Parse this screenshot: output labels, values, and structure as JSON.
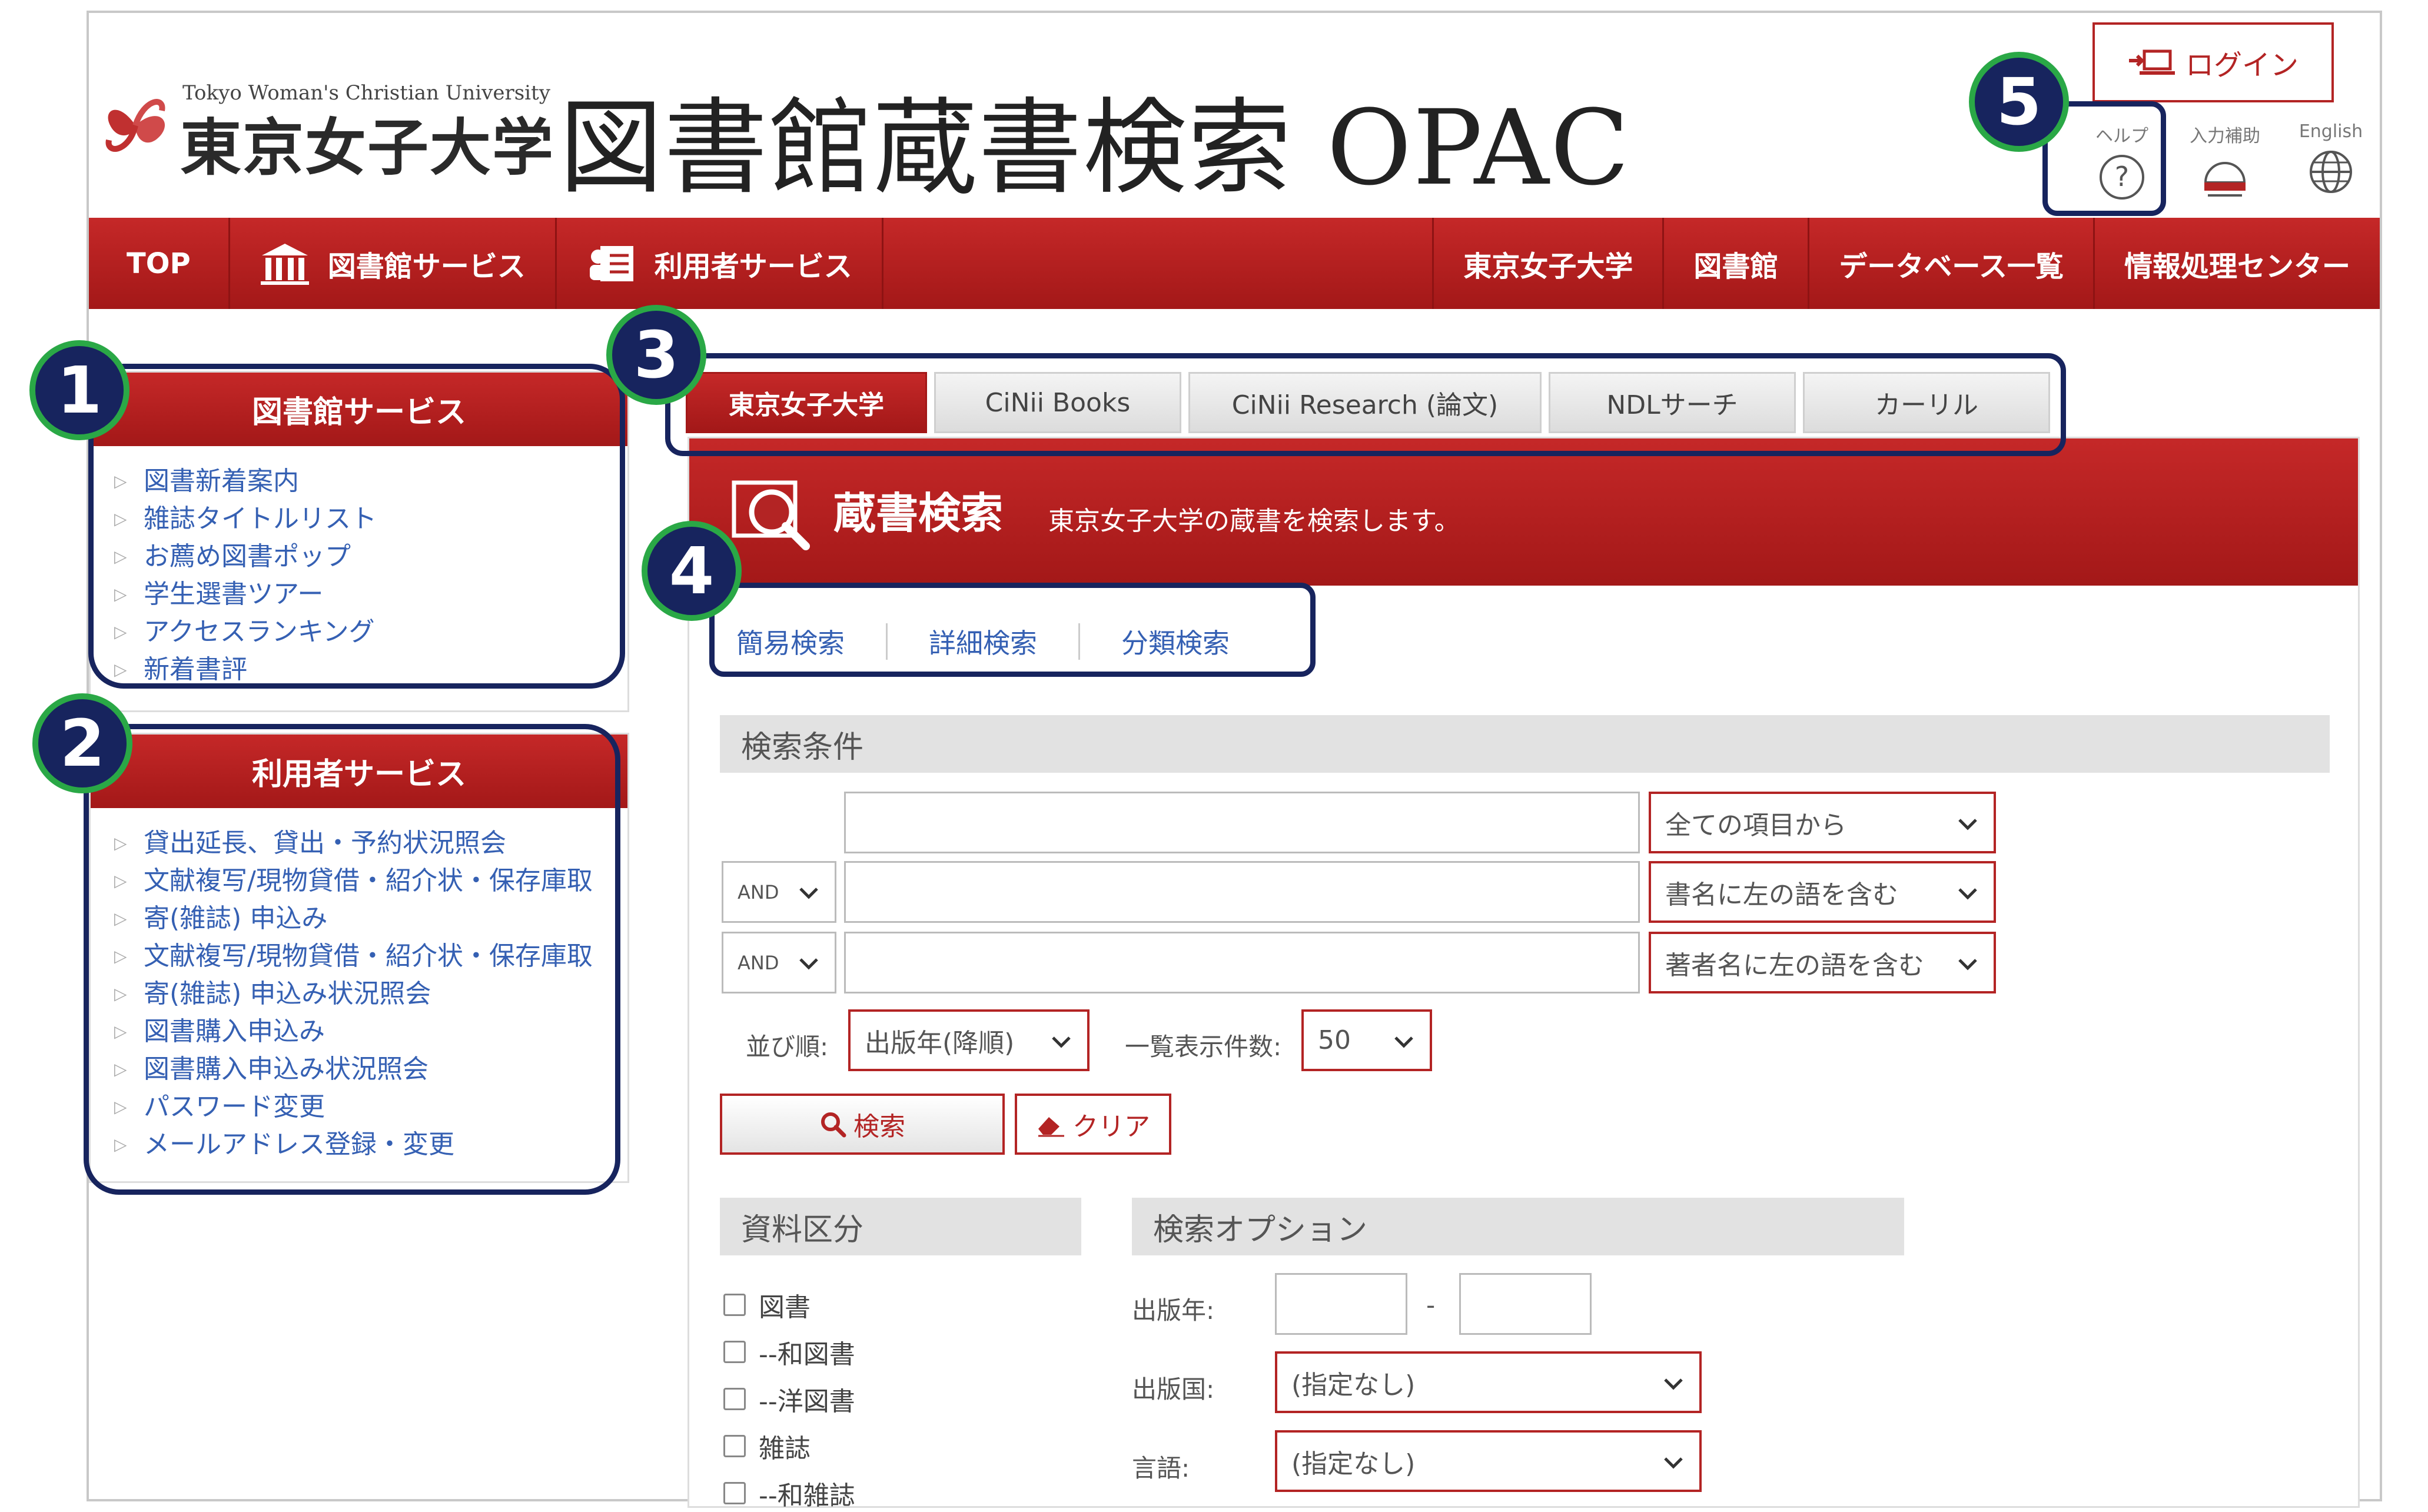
{
  "header": {
    "logo_en": "Tokyo Woman's Christian University",
    "logo_jp": "東京女子大学",
    "page_title": "図書館蔵書検索 OPAC",
    "login_label": "ログイン",
    "help_label": "ヘルプ",
    "input_assist_label": "入力補助",
    "english_label": "English"
  },
  "nav": {
    "top": "TOP",
    "library_services": "図書館サービス",
    "user_services": "利用者サービス",
    "univ": "東京女子大学",
    "library": "図書館",
    "database_list": "データベース一覧",
    "it_center": "情報処理センター"
  },
  "sidebar_library": {
    "title": "図書館サービス",
    "items": [
      "図書新着案内",
      "雑誌タイトルリスト",
      "お薦め図書ポップ",
      "学生選書ツアー",
      "アクセスランキング",
      "新着書評"
    ]
  },
  "sidebar_user": {
    "title": "利用者サービス",
    "items": [
      "貸出延長、貸出・予約状況照会",
      "文献複写/現物貸借・紹介状・保存庫取",
      "寄(雑誌) 申込み",
      "文献複写/現物貸借・紹介状・保存庫取",
      "寄(雑誌) 申込み状況照会",
      "図書購入申込み",
      "図書購入申込み状況照会",
      "パスワード変更",
      "メールアドレス登録・変更"
    ]
  },
  "tabs": [
    "東京女子大学",
    "CiNii Books",
    "CiNii Research (論文)",
    "NDLサーチ",
    "カーリル"
  ],
  "panel": {
    "title": "蔵書検索",
    "description": "東京女子大学の蔵書を検索します。",
    "subtabs": [
      "簡易検索",
      "詳細検索",
      "分類検索"
    ],
    "conditions_title": "検索条件",
    "field1_select": "全ての項目から",
    "field2_select": "書名に左の語を含む",
    "field3_select": "著者名に左の語を含む",
    "op2": "AND",
    "op3": "AND",
    "sort_label": "並び順:",
    "sort_value": "出版年(降順)",
    "count_label": "一覧表示件数:",
    "count_value": "50",
    "search_button": "検索",
    "clear_button": "クリア",
    "material_title": "資料区分",
    "materials": [
      "図書",
      "--和図書",
      "--洋図書",
      "雑誌",
      "--和雑誌"
    ],
    "options_title": "検索オプション",
    "pub_year_label": "出版年:",
    "pub_year_sep": "-",
    "pub_country_label": "出版国:",
    "pub_country_value": "(指定なし)",
    "language_label": "言語:",
    "language_value": "(指定なし)"
  },
  "annotations": [
    "1",
    "2",
    "3",
    "4",
    "5"
  ],
  "colors": {
    "brand_red": "#b32424",
    "annotation_navy": "#17245e",
    "annotation_green": "#2aa846",
    "link_blue": "#3560b3"
  }
}
